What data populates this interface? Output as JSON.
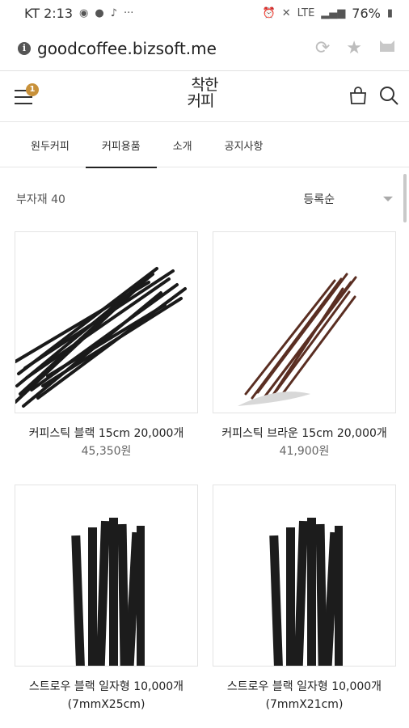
{
  "status": {
    "carrier_time": "KT 2:13",
    "battery": "76%",
    "network": "LTE"
  },
  "browser": {
    "url": "goodcoffee.bizsoft.me"
  },
  "header": {
    "logo_line1": "착한",
    "logo_line2": "커피",
    "cart_count": "1"
  },
  "nav": {
    "tabs": [
      {
        "label": "원두커피"
      },
      {
        "label": "커피용품"
      },
      {
        "label": "소개"
      },
      {
        "label": "공지사항"
      }
    ],
    "active": 1
  },
  "list": {
    "count_label": "부자재 40",
    "sort_label": "등록순"
  },
  "products": [
    {
      "name": "커피스틱 블랙 15cm 20,000개",
      "price": "45,350원",
      "image": "black-stirrers-bundle",
      "color": "#1a1a1a"
    },
    {
      "name": "커피스틱 브라운 15cm 20,000개",
      "price": "41,900원",
      "image": "brown-stirrers-bundle",
      "color": "#5a2e22"
    },
    {
      "name": "스트로우 블랙 일자형 10,000개 (7mmX25cm)",
      "price": "",
      "image": "black-straws-upright",
      "color": "#1c1c1c"
    },
    {
      "name": "스트로우 블랙 일자형 10,000개 (7mmX21cm)",
      "price": "",
      "image": "black-straws-upright",
      "color": "#1c1c1c"
    }
  ]
}
